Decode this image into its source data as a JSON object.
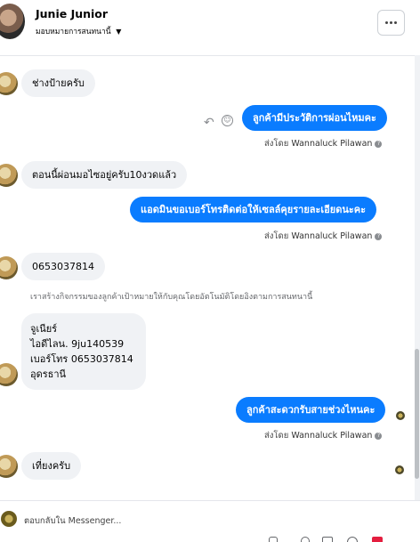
{
  "header": {
    "name": "Junie Junior",
    "assign_label": "มอบหมายการสนทนานี้"
  },
  "messages": {
    "m1": "ช่างป้ายครับ",
    "m2": "ลูกค้ามีประวัติการผ่อนไหมคะ",
    "m3": "ตอนนี้ผ่อนมอไซอยู่ครับ10งวดแล้ว",
    "m4": "แอดมินขอเบอร์โทรติดต่อให้เซลล์คุยรายละเอียดนะคะ",
    "m5": "0653037814",
    "m6_lines": [
      "จูเนียร์",
      "ไอดีไลน. 9ju140539",
      "เบอร์โทร 0653037814",
      "อุดรธานี"
    ],
    "m7": "ลูกค้าสะดวกรับสายช่วงไหนคะ",
    "m8": "เที่ยงครับ"
  },
  "sent_by_prefix": "ส่งโดย",
  "sender": "Wannaluck Pilawan",
  "system_note": "เราสร้างกิจกรรมของลูกค้าเป้าหมายให้กับคุณโดยอัตโนมัติโดยอิงตามการสนทนานี้",
  "composer": {
    "placeholder": "ตอบกลับใน Messenger..."
  }
}
